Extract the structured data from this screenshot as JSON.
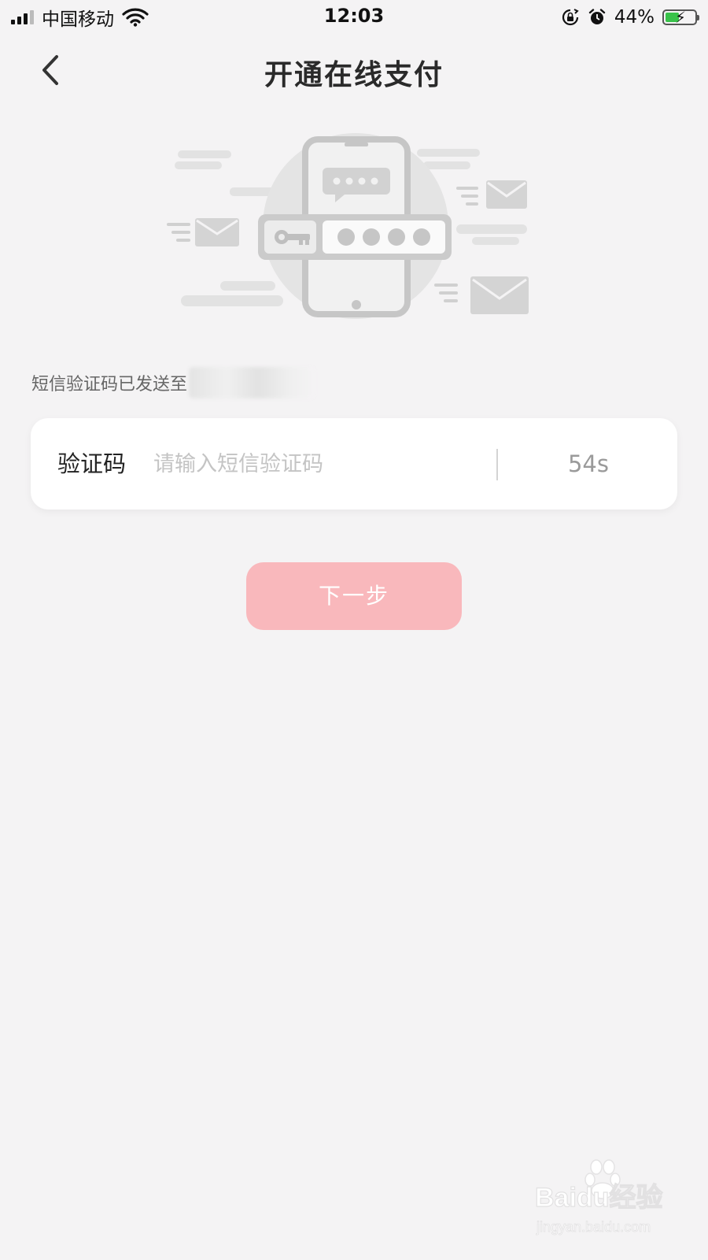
{
  "status_bar": {
    "carrier": "中国移动",
    "time": "12:03",
    "battery_percent": "44%",
    "icons": [
      "signal-icon",
      "wifi-icon",
      "rotation-lock-icon",
      "alarm-icon",
      "battery-icon"
    ]
  },
  "nav": {
    "title": "开通在线支付",
    "back_icon": "chevron-left-icon"
  },
  "hint": {
    "text": "短信验证码已发送至"
  },
  "code_field": {
    "label": "验证码",
    "placeholder": "请输入短信验证码",
    "value": "",
    "countdown": "54s"
  },
  "next_button": {
    "label": "下一步"
  },
  "colors": {
    "background": "#f4f3f4",
    "card": "#ffffff",
    "button_disabled": "#f9b8bc",
    "battery_fill": "#39c24a"
  },
  "watermark": {
    "brand": "Baidu经验",
    "url": "jingyan.baidu.com"
  }
}
